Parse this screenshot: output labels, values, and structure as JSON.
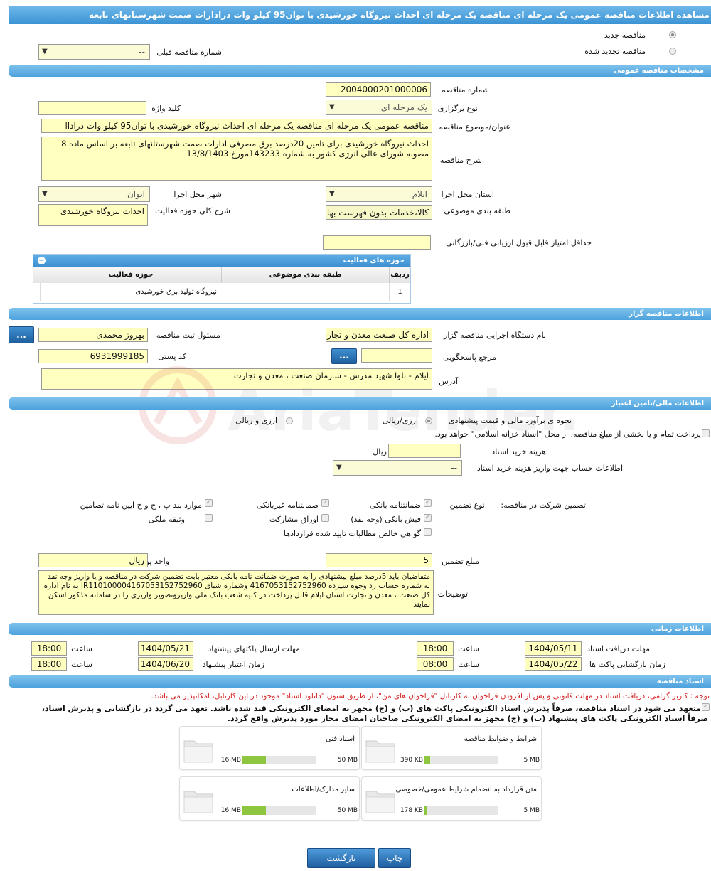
{
  "title": "مشاهده اطلاعات مناقصه عمومی یک مرحله ای مناقصه یک مرحله ای احداث نیروگاه خورشیدی با توان95 کیلو وات درادارات صمت شهرستانهای تابعه",
  "top": {
    "new_tender": "مناقصه جدید",
    "renewed_tender": "مناقصه تجدید شده",
    "prev_tender_label": "شماره مناقصه قبلی",
    "prev_tender_value": "--"
  },
  "general": {
    "header": "مشخصات مناقصه عمومی",
    "number_label": "شماره مناقصه",
    "number_value": "2004000201000006",
    "holding_type_label": "نوع برگزاری",
    "holding_type_value": "یک مرحله ای",
    "keyword_label": "کلید واژه",
    "keyword_value": "",
    "subject_label": "عنوان/موضوع مناقصه",
    "subject_value": "مناقصه عمومی یک مرحله ای مناقصه یک مرحله ای احداث نیروگاه خورشیدی با توان95 کیلو وات دراداا",
    "desc_label": "شرح مناقصه",
    "desc_value": "احداث نیروگاه خورشیدی برای تامین 20درصد برق مصرفی ادارات صمت شهرستانهای تابعه بر اساس ماده 8 مصوبه شورای عالی انرژی کشور به شماره 143233مورخ 13/8/1403",
    "province_label": "استان محل اجرا",
    "province_value": "ایلام",
    "city_label": "شهر محل اجرا",
    "city_value": "ایوان",
    "category_label": "طبقه بندی موضوعی",
    "category_value": "کالا،خدمات بدون فهرست بها",
    "activity_desc_label": "شرح کلی حوزه فعالیت",
    "activity_desc_value": "احداث نیروگاه خورشیدی",
    "min_score_label": "حداقل امتیاز قابل قبول ارزیابی فنی/بازرگانی",
    "min_score_value": ""
  },
  "activity_grid": {
    "title": "حوزه های فعالیت",
    "col_row": "ردیف",
    "col_category": "طبقه بندی موضوعی",
    "col_field": "حوزه فعالیت",
    "rows": [
      {
        "row": "1",
        "category": "",
        "field": "نیروگاه تولید برق خورشیدی"
      }
    ]
  },
  "organizer": {
    "header": "اطلاعات مناقصه گزار",
    "agency_label": "نام دستگاه اجرایی مناقصه گزار",
    "agency_value": "اداره کل صنعت  معدن و تجارت",
    "registrar_label": "مسئول ثبت مناقصه",
    "registrar_value": "بهروز محمدی",
    "reference_label": "مرجع پاسخگویی",
    "reference_value": "",
    "postal_label": "کد پستی",
    "postal_value": "6931999185",
    "address_label": "آدرس",
    "address_value": "ایلام - بلوا شهید مدرس - سازمان صنعت ، معدن و تجارت",
    "dots": "..."
  },
  "finance": {
    "header": "اطلاعات مالی/تامین اعتبار",
    "estimate_label": "نحوه ی برآورد مالی و قیمت پیشنهادی",
    "opt_rial_fx": "ارزی/ریالی",
    "opt_fx_rial": "ارزی و ریالی",
    "treasury_text": "پرداخت تمام و یا بخشی از مبلغ مناقصه، از محل \"اسناد خزانه اسلامی\" خواهد بود.",
    "doc_cost_label": "هزینه خرید اسناد",
    "doc_cost_value": "",
    "doc_cost_unit": "ریال",
    "account_label": "اطلاعات حساب جهت واریز هزینه خرید اسناد",
    "account_value": "--"
  },
  "guarantee": {
    "participation_label": "تضمین شرکت در مناقصه:",
    "type_label": "نوع تضمین",
    "bank_guarantee": "ضمانتنامه بانکی",
    "nonbank_guarantee": "ضمانتنامه غیربانکی",
    "bylaw_items": "موارد بند پ ، ج و خ آیین نامه تضامین",
    "bank_receipt": "فیش بانکی (وجه نقد)",
    "partnership_bonds": "اوراق مشارکت",
    "property_pledge": "وثیقه ملکی",
    "net_claims": "گواهی خالص مطالبات تایید شده قراردادها",
    "amount_label": "مبلغ تضمین",
    "amount_value": "5",
    "currency_label": "واحد پول",
    "currency_value": "ریال",
    "notes_label": "توضیحات",
    "notes_value": "متقاضیان باید 5درصد مبلغ پیشنهادی را  به صورت ضمانت نامه بانکی معتبر بابت تضمین شرکت در مناقصه و یا واریز وجه نقد به شماره حساب  رد وجوه سپرده 4167053152752960 وشماره شبای IR110100004167053152752960  به نام اداره کل صنعت ، معدن و تجارت استان ایلام قابل پرداخت در کلیه شعب بانک ملی واریزوتصویر واریزی را در سامانه مذکور اسکن نمایند"
  },
  "timing": {
    "header": "اطلاعات زمانی",
    "receive_deadline_label": "مهلت دریافت اسناد",
    "receive_deadline_date": "1404/05/11",
    "receive_deadline_time": "18:00",
    "send_deadline_label": "مهلت ارسال پاکتهای پیشنهاد",
    "send_deadline_date": "1404/05/21",
    "send_deadline_time": "18:00",
    "opening_label": "زمان بازگشایی پاکت ها",
    "opening_date": "1404/05/22",
    "opening_time": "08:00",
    "validity_label": "زمان اعتبار پیشنهاد",
    "validity_date": "1404/06/20",
    "validity_time": "18:00",
    "time_label": "ساعت"
  },
  "documents": {
    "header": "اسناد مناقصه",
    "notice": "توجه : کاربر گرامی، دریافت اسناد در مهلت قانونی و پس از افزودن فراخوان به کارتابل \"فراخوان های من\"، از طریق ستون \"دانلود اسناد\" موجود در این کارتابل، امکانپذیر می باشد.",
    "commit_line1": "متعهد می شود در اسناد مناقصه، صرفاً پذیرش اسناد الکترونیکی پاکت های (ب) و (ج) مجهز به امضای الکترونیکی قید شده باشد. تعهد می گردد در بازگشایی و پذیرش اسناد،",
    "commit_line2": "صرفاً اسناد الکترونیکی پاکت های پیشنهاد (ب) و (ج) مجهز به امضای الکترونیکی صاحبان امضای مجاز مورد پذیرش واقع گردد.",
    "files": [
      {
        "name": "شرایط و ضوابط مناقصه",
        "used": "390 KB",
        "max": "5 MB",
        "fraction": 0.08
      },
      {
        "name": "اسناد فنی",
        "used": "16 MB",
        "max": "50 MB",
        "fraction": 0.32
      },
      {
        "name": "متن قرارداد به انضمام شرایط عمومی/خصوصی",
        "used": "178 KB",
        "max": "5 MB",
        "fraction": 0.04
      },
      {
        "name": "سایر مدارک/اطلاعات",
        "used": "16 MB",
        "max": "50 MB",
        "fraction": 0.32
      }
    ]
  },
  "footer": {
    "print": "چاپ",
    "back": "بازگشت"
  },
  "watermark": "AriaTender.neT"
}
